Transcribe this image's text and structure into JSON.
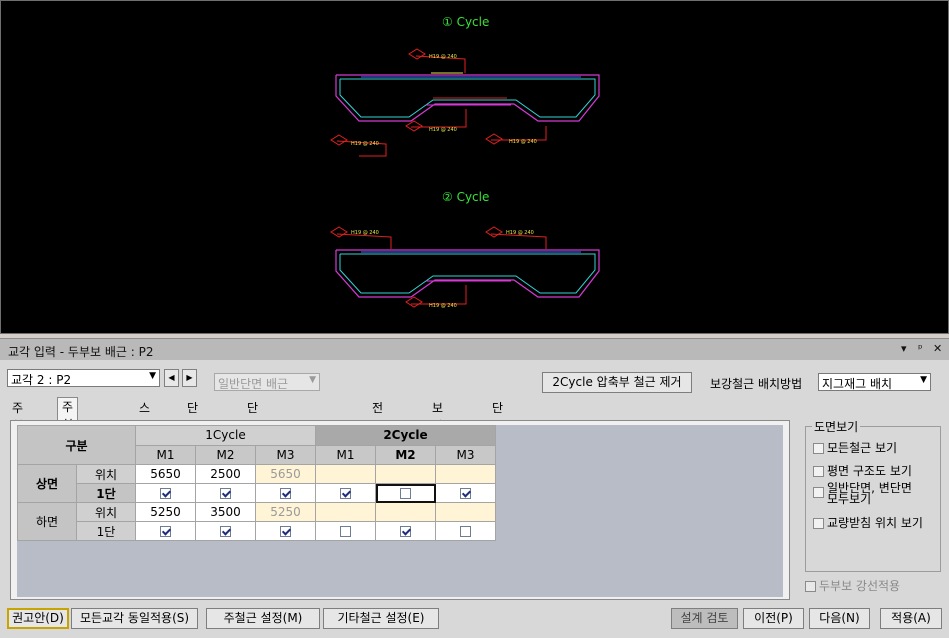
{
  "cad": {
    "cycle1_title": "① Cycle",
    "cycle2_title": "② Cycle",
    "bar_label": "H19 @ 240"
  },
  "window": {
    "title": "교각 입력 - 두부보 배근 : P2",
    "ctrl_pin": "▾ ᵖ ✕"
  },
  "toolbar": {
    "pier_select": "교각 2 : P2",
    "section_select": "일반단면 배근",
    "remove_button": "2Cycle 압축부 철근 제거",
    "method_label": "보강철근 배치방법",
    "method_select": "지그재그 배치"
  },
  "tabs": [
    "주철근",
    "주철근 배치",
    "스터럽",
    "단차철근",
    "단차철근 횡방향간격",
    "전단철근",
    "보강철근",
    "단면표현위치"
  ],
  "grid": {
    "corner": "구분",
    "cycle1": "1Cycle",
    "cycle2": "2Cycle",
    "cols": [
      "M1",
      "M2",
      "M3",
      "M1",
      "M2",
      "M3"
    ],
    "top": "상면",
    "bottom": "하면",
    "pos_label": "위치",
    "tier_label": "1단",
    "top_pos": [
      "5650",
      "2500",
      "5650"
    ],
    "bottom_pos": [
      "5250",
      "3500",
      "5250"
    ],
    "top_checks": [
      true,
      true,
      true,
      true,
      false,
      true
    ],
    "bottom_checks": [
      true,
      true,
      true,
      false,
      true,
      false
    ]
  },
  "view": {
    "group_title": "도면보기",
    "opt1": "모든철근 보기",
    "opt2": "평면 구조도 보기",
    "opt3a": "일반단면, 변단면",
    "opt3b": "모두보기",
    "opt4": "교량받침 위치 보기",
    "strong_apply": "두부보 강선적용"
  },
  "footer": {
    "recommend": "권고안(D)",
    "apply_all": "모든교각 동일적용(S)",
    "main_setting": "주철근 설정(M)",
    "other_setting": "기타철근 설정(E)",
    "design_check": "설계 검토",
    "prev": "이전(P)",
    "next": "다음(N)",
    "apply": "적용(A)"
  },
  "colors": {
    "cad_background": "#000000",
    "section_outline": "#d63ad6",
    "section_inner": "#32d6d6",
    "rebar": "#e02020",
    "label": "#e6e64a",
    "title_green": "#36e336"
  }
}
